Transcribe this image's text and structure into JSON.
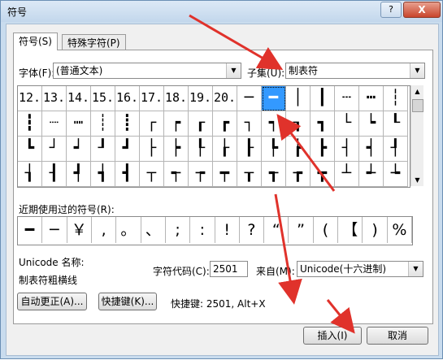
{
  "window": {
    "title": "符号",
    "help_label": "?",
    "close_label": "X"
  },
  "tabs": [
    {
      "label": "符号(S)"
    },
    {
      "label": "特殊字符(P)"
    }
  ],
  "font": {
    "label": "字体(F):",
    "value": "(普通文本)"
  },
  "subset": {
    "label": "子集(U):",
    "value": "制表符"
  },
  "symbol_grid": {
    "selected_index": 10,
    "rows": [
      [
        "12.",
        "13.",
        "14.",
        "15.",
        "16.",
        "17.",
        "18.",
        "19.",
        "20.",
        "─",
        "━",
        "│",
        "┃",
        "┄",
        "┅",
        "┆"
      ],
      [
        "┇",
        "┈",
        "┉",
        "┊",
        "┋",
        "┌",
        "┍",
        "┎",
        "┏",
        "┐",
        "┑",
        "┒",
        "┓",
        "└",
        "┕",
        "┖"
      ],
      [
        "┗",
        "┘",
        "┙",
        "┚",
        "┛",
        "├",
        "┝",
        "┞",
        "┟",
        "┠",
        "┡",
        "┢",
        "┣",
        "┤",
        "┥",
        "┦"
      ],
      [
        "┧",
        "┨",
        "┩",
        "┪",
        "┫",
        "┬",
        "┭",
        "┮",
        "┯",
        "┰",
        "┱",
        "┲",
        "┳",
        "┴",
        "┵",
        "┶"
      ]
    ]
  },
  "recent": {
    "label": "近期使用过的符号(R):",
    "symbols": [
      "━",
      "─",
      "￥",
      ",",
      "。",
      "、",
      ";",
      ":",
      "!",
      "?",
      "“",
      "”",
      "(",
      "【",
      ")",
      "%"
    ]
  },
  "unicode": {
    "name_label": "Unicode 名称:",
    "name_value": "制表符粗横线"
  },
  "char_code": {
    "label": "字符代码(C):",
    "value": "2501"
  },
  "from": {
    "label": "来自(M):",
    "value": "Unicode(十六进制)"
  },
  "buttons": {
    "autocorrect": "自动更正(A)...",
    "shortcut_key": "快捷键(K)...",
    "insert": "插入(I)",
    "cancel": "取消"
  },
  "shortcut_text": "快捷键: 2501, Alt+X",
  "colors": {
    "selection": "#3399ff",
    "annotation_arrow": "#e0322b"
  }
}
